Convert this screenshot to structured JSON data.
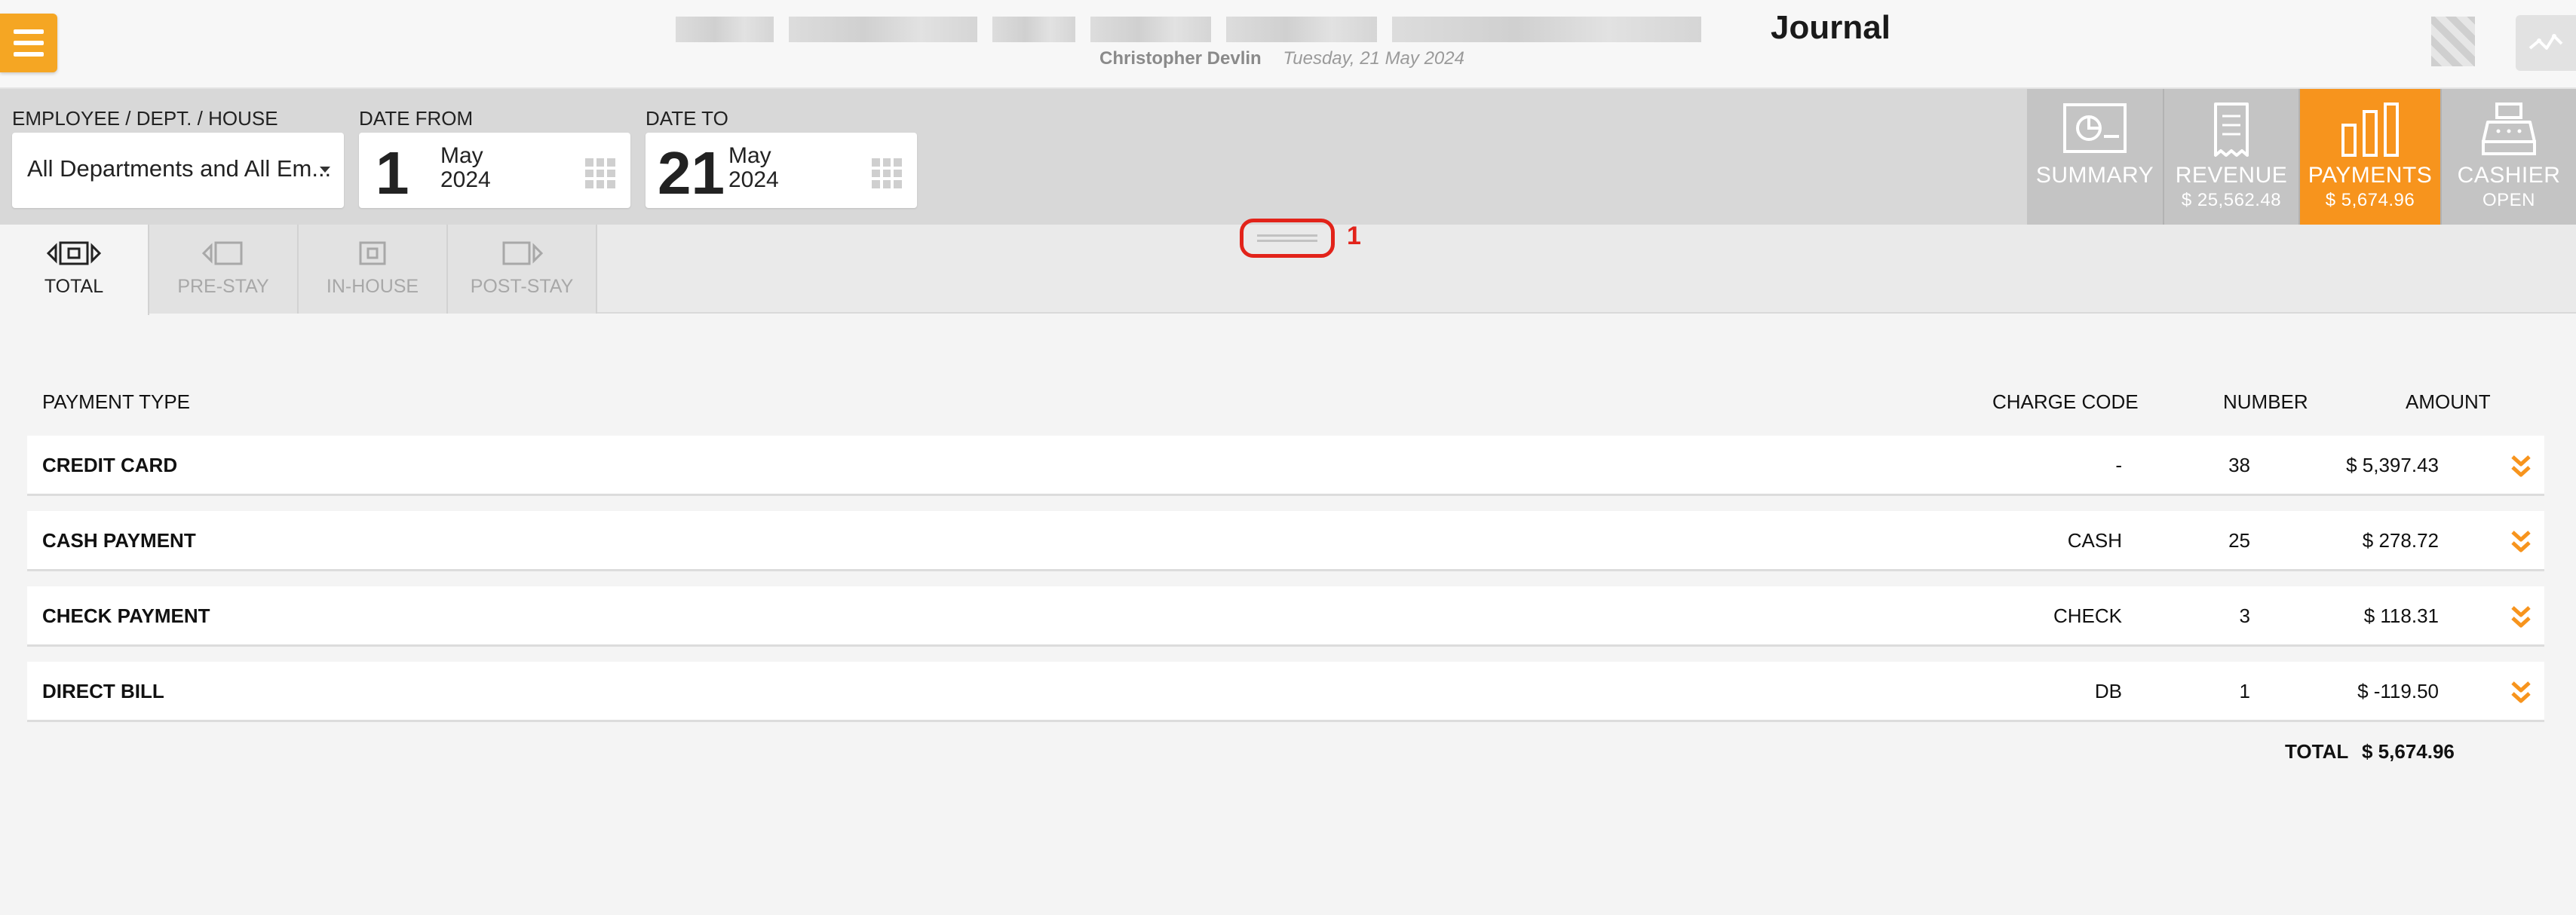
{
  "header": {
    "title": "Journal",
    "user_name": "Christopher Devlin",
    "date": "Tuesday, 21 May 2024"
  },
  "filters": {
    "employee_label": "EMPLOYEE / DEPT. / HOUSE",
    "employee_value": "All Departments and All Em...",
    "date_from_label": "DATE FROM",
    "date_from": {
      "day": "1",
      "month": "May",
      "year": "2024"
    },
    "date_to_label": "DATE TO",
    "date_to": {
      "day": "21",
      "month": "May",
      "year": "2024"
    }
  },
  "nav_tiles": [
    {
      "label": "SUMMARY",
      "sub": "",
      "icon": "summary-chart-icon"
    },
    {
      "label": "REVENUE",
      "sub": "$ 25,562.48",
      "icon": "receipt-icon"
    },
    {
      "label": "PAYMENTS",
      "sub": "$ 5,674.96",
      "icon": "bar-chart-icon",
      "active": true
    },
    {
      "label": "CASHIER",
      "sub": "OPEN",
      "icon": "cash-register-icon"
    }
  ],
  "stay_tabs": [
    {
      "label": "TOTAL",
      "active": true
    },
    {
      "label": "PRE-STAY"
    },
    {
      "label": "IN-HOUSE"
    },
    {
      "label": "POST-STAY"
    }
  ],
  "annotation": {
    "marker": "1"
  },
  "table": {
    "headers": {
      "type": "PAYMENT TYPE",
      "code": "CHARGE CODE",
      "number": "NUMBER",
      "amount": "AMOUNT"
    },
    "rows": [
      {
        "type": "CREDIT CARD",
        "code": "-",
        "number": "38",
        "amount": "$ 5,397.43"
      },
      {
        "type": "CASH PAYMENT",
        "code": "CASH",
        "number": "25",
        "amount": "$ 278.72"
      },
      {
        "type": "CHECK PAYMENT",
        "code": "CHECK",
        "number": "3",
        "amount": "$ 118.31"
      },
      {
        "type": "DIRECT BILL",
        "code": "DB",
        "number": "1",
        "amount": "$ -119.50"
      }
    ],
    "total_label": "TOTAL",
    "total_value": "$ 5,674.96"
  },
  "colors": {
    "accent": "#f7941d",
    "menu": "#f5a623",
    "tile": "#c4c4c4",
    "annotation": "#e2231a"
  }
}
